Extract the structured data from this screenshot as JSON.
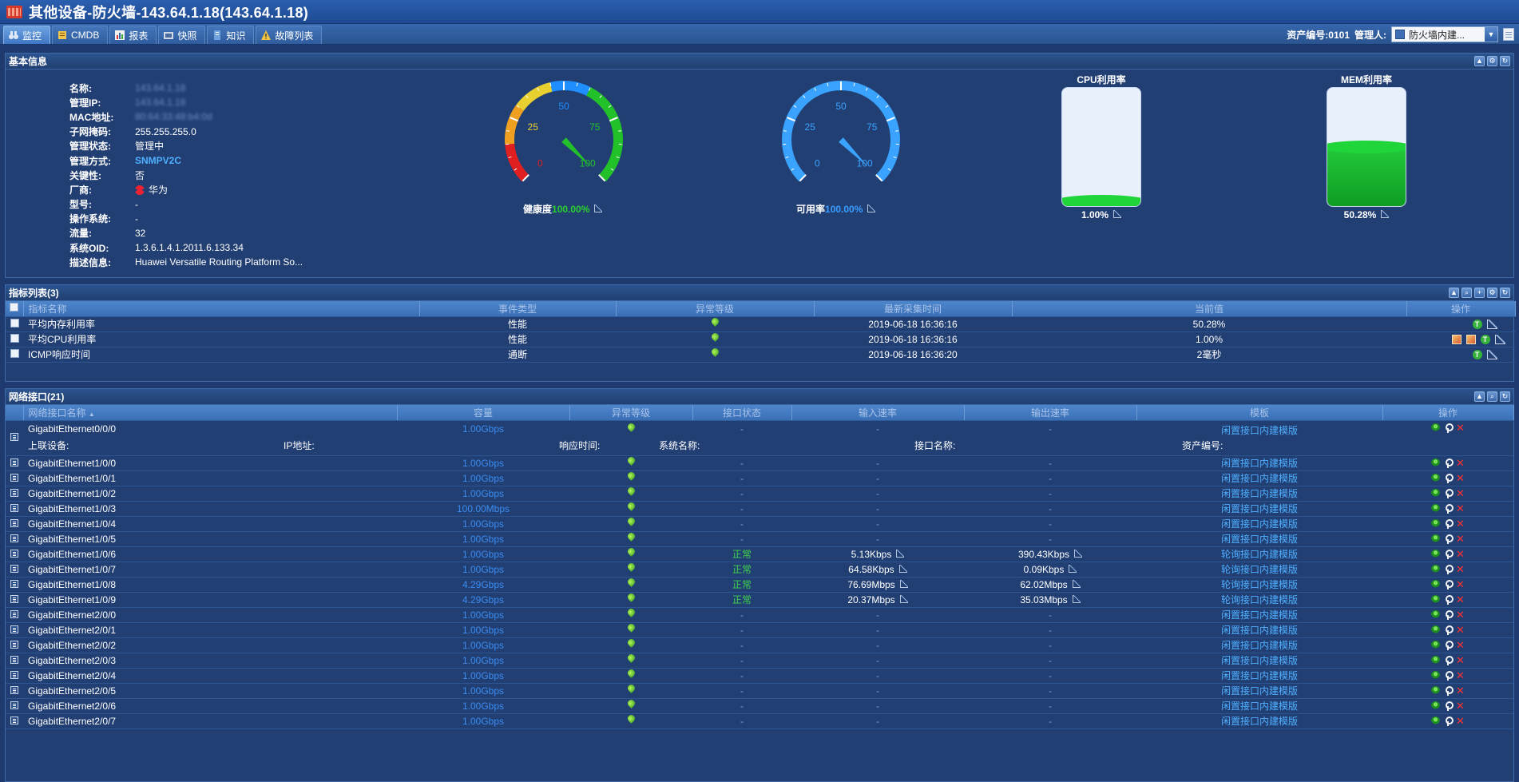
{
  "window": {
    "title": "其他设备-防火墙-143.64.1.18(143.64.1.18)"
  },
  "tabs": [
    {
      "label": "监控",
      "icon": "binoculars-icon",
      "active": true
    },
    {
      "label": "CMDB",
      "icon": "database-icon"
    },
    {
      "label": "报表",
      "icon": "report-icon"
    },
    {
      "label": "快照",
      "icon": "snapshot-icon"
    },
    {
      "label": "知识",
      "icon": "knowledge-icon"
    },
    {
      "label": "故障列表",
      "icon": "warning-icon"
    }
  ],
  "header_right": {
    "asset_no": "资产编号:0101",
    "manager_label": "管理人:",
    "manager_value": "防火墙内建..."
  },
  "basic": {
    "title": "基本信息",
    "fields": [
      {
        "k": "名称:",
        "v": "143.64.1.18"
      },
      {
        "k": "管理IP:",
        "v": "143.64.1.18"
      },
      {
        "k": "MAC地址:",
        "v": "80:64:33:48:b4:0d"
      },
      {
        "k": "子网掩码:",
        "v": "255.255.255.0"
      },
      {
        "k": "管理状态:",
        "v": "管理中"
      },
      {
        "k": "管理方式:",
        "v": "SNMPV2C"
      },
      {
        "k": "关键性:",
        "v": "否"
      },
      {
        "k": "厂商:",
        "v": "华为"
      },
      {
        "k": "型号:",
        "v": "-"
      },
      {
        "k": "操作系统:",
        "v": "-"
      },
      {
        "k": "流量:",
        "v": "32"
      },
      {
        "k": "系统OID:",
        "v": "1.3.6.1.4.1.2011.6.133.34"
      },
      {
        "k": "描述信息:",
        "v": "Huawei Versatile Routing Platform So..."
      }
    ],
    "health": {
      "label": "健康度",
      "value": "100.00%",
      "ticks": [
        "0",
        "25",
        "50",
        "75",
        "100"
      ],
      "percent": 100
    },
    "availability": {
      "label": "可用率",
      "value": "100.00%",
      "ticks": [
        "0",
        "25",
        "50",
        "75",
        "100"
      ],
      "percent": 100
    },
    "cpu": {
      "title": "CPU利用率",
      "value": "1.00%",
      "percent": 1.0
    },
    "mem": {
      "title": "MEM利用率",
      "value": "50.28%",
      "percent": 50.28
    }
  },
  "metrics": {
    "title": "指标列表(3)",
    "columns": [
      "指标名称",
      "事件类型",
      "异常等级",
      "最新采集时间",
      "当前值",
      "操作"
    ],
    "rows": [
      {
        "name": "平均内存利用率",
        "type": "性能",
        "time": "2019-06-18 16:36:16",
        "value": "50.28%",
        "extra": false
      },
      {
        "name": "平均CPU利用率",
        "type": "性能",
        "time": "2019-06-18 16:36:16",
        "value": "1.00%",
        "extra": true
      },
      {
        "name": "ICMP响应时间",
        "type": "通断",
        "time": "2019-06-18 16:36:20",
        "value": "2毫秒",
        "extra": false
      }
    ]
  },
  "ifaces": {
    "title": "网络接口(21)",
    "columns": [
      "网络接口名称",
      "容量",
      "异常等级",
      "接口状态",
      "输入速率",
      "输出速率",
      "模板",
      "操作"
    ],
    "detail_labels": {
      "upstream": "上联设备:",
      "ip": "IP地址:",
      "resp": "响应时间:",
      "sysname": "系统名称:",
      "ifname": "接口名称:",
      "asset": "资产编号:"
    },
    "rows": [
      {
        "name": "GigabitEthernet0/0/0",
        "cap": "1.00Gbps",
        "status": "-",
        "in": "-",
        "out": "-",
        "tpl": "闲置接口内建模版",
        "expanded": true
      },
      {
        "name": "GigabitEthernet1/0/0",
        "cap": "1.00Gbps",
        "status": "-",
        "in": "-",
        "out": "-",
        "tpl": "闲置接口内建模版"
      },
      {
        "name": "GigabitEthernet1/0/1",
        "cap": "1.00Gbps",
        "status": "-",
        "in": "-",
        "out": "-",
        "tpl": "闲置接口内建模版"
      },
      {
        "name": "GigabitEthernet1/0/2",
        "cap": "1.00Gbps",
        "status": "-",
        "in": "-",
        "out": "-",
        "tpl": "闲置接口内建模版"
      },
      {
        "name": "GigabitEthernet1/0/3",
        "cap": "100.00Mbps",
        "status": "-",
        "in": "-",
        "out": "-",
        "tpl": "闲置接口内建模版"
      },
      {
        "name": "GigabitEthernet1/0/4",
        "cap": "1.00Gbps",
        "status": "-",
        "in": "-",
        "out": "-",
        "tpl": "闲置接口内建模版"
      },
      {
        "name": "GigabitEthernet1/0/5",
        "cap": "1.00Gbps",
        "status": "-",
        "in": "-",
        "out": "-",
        "tpl": "闲置接口内建模版"
      },
      {
        "name": "GigabitEthernet1/0/6",
        "cap": "1.00Gbps",
        "status": "正常",
        "in": "5.13Kbps",
        "out": "390.43Kbps",
        "tpl": "轮询接口内建模版"
      },
      {
        "name": "GigabitEthernet1/0/7",
        "cap": "1.00Gbps",
        "status": "正常",
        "in": "64.58Kbps",
        "out": "0.09Kbps",
        "tpl": "轮询接口内建模版"
      },
      {
        "name": "GigabitEthernet1/0/8",
        "cap": "4.29Gbps",
        "status": "正常",
        "in": "76.69Mbps",
        "out": "62.02Mbps",
        "tpl": "轮询接口内建模版"
      },
      {
        "name": "GigabitEthernet1/0/9",
        "cap": "4.29Gbps",
        "status": "正常",
        "in": "20.37Mbps",
        "out": "35.03Mbps",
        "tpl": "轮询接口内建模版"
      },
      {
        "name": "GigabitEthernet2/0/0",
        "cap": "1.00Gbps",
        "status": "-",
        "in": "-",
        "out": "-",
        "tpl": "闲置接口内建模版"
      },
      {
        "name": "GigabitEthernet2/0/1",
        "cap": "1.00Gbps",
        "status": "-",
        "in": "-",
        "out": "-",
        "tpl": "闲置接口内建模版"
      },
      {
        "name": "GigabitEthernet2/0/2",
        "cap": "1.00Gbps",
        "status": "-",
        "in": "-",
        "out": "-",
        "tpl": "闲置接口内建模版"
      },
      {
        "name": "GigabitEthernet2/0/3",
        "cap": "1.00Gbps",
        "status": "-",
        "in": "-",
        "out": "-",
        "tpl": "闲置接口内建模版"
      },
      {
        "name": "GigabitEthernet2/0/4",
        "cap": "1.00Gbps",
        "status": "-",
        "in": "-",
        "out": "-",
        "tpl": "闲置接口内建模版"
      },
      {
        "name": "GigabitEthernet2/0/5",
        "cap": "1.00Gbps",
        "status": "-",
        "in": "-",
        "out": "-",
        "tpl": "闲置接口内建模版"
      },
      {
        "name": "GigabitEthernet2/0/6",
        "cap": "1.00Gbps",
        "status": "-",
        "in": "-",
        "out": "-",
        "tpl": "闲置接口内建模版"
      },
      {
        "name": "GigabitEthernet2/0/7",
        "cap": "1.00Gbps",
        "status": "-",
        "in": "-",
        "out": "-",
        "tpl": "闲置接口内建模版"
      }
    ]
  },
  "colors": {
    "accent_blue": "#4fb0ff",
    "normal_green": "#3fd24a",
    "delete_red": "#ff3030",
    "health_pct": "#2ad12f",
    "avail_pct": "#3b9cff"
  }
}
